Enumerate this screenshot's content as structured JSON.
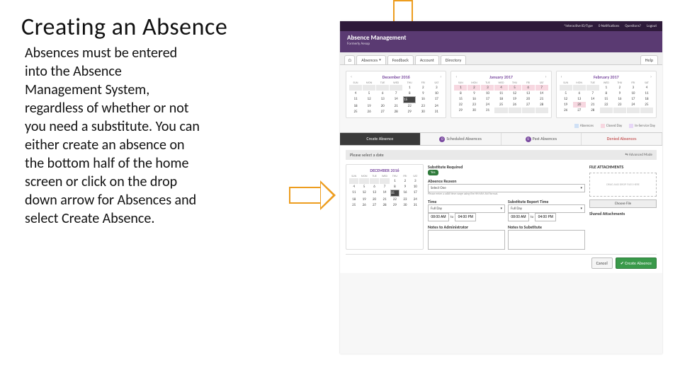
{
  "slide": {
    "title": "Creating an Absence",
    "body": "Absences must be entered into the Absence Management System, regardless of whether or not you need a substitute.  You can either create an absence on the bottom half of the home screen or click on the drop down arrow for Absences and select Create Absence."
  },
  "topbar": {
    "idtype": "*Interactive ID/Type",
    "notif": "0 Notifications",
    "questions": "Questions?",
    "logout": "Logout"
  },
  "brand": {
    "title": "Absence Management",
    "subtitle": "Formerly Aesop"
  },
  "tabs": {
    "home": "⌂",
    "absences": "Absences",
    "feedback": "Feedback",
    "account": "Account",
    "directory": "Directory",
    "help": "Help"
  },
  "dow": [
    "SUN",
    "MON",
    "TUE",
    "WED",
    "THU",
    "FRI",
    "SAT"
  ],
  "months": [
    {
      "title": "December 2016",
      "weeks": [
        [
          "",
          "",
          "",
          "",
          "1",
          "2",
          "3"
        ],
        [
          "4",
          "5",
          "6",
          "7",
          "8",
          "9",
          "10"
        ],
        [
          "11",
          "12",
          "13",
          "14",
          "15",
          "16",
          "17"
        ],
        [
          "18",
          "19",
          "20",
          "21",
          "22",
          "23",
          "24"
        ],
        [
          "25",
          "26",
          "27",
          "28",
          "29",
          "30",
          "31"
        ]
      ],
      "sel": "15"
    },
    {
      "title": "January 2017",
      "weeks": [
        [
          "1",
          "2",
          "3",
          "4",
          "5",
          "6",
          "7"
        ],
        [
          "8",
          "9",
          "10",
          "11",
          "12",
          "13",
          "14"
        ],
        [
          "15",
          "16",
          "17",
          "18",
          "19",
          "20",
          "21"
        ],
        [
          "22",
          "23",
          "24",
          "25",
          "26",
          "27",
          "28"
        ],
        [
          "29",
          "30",
          "31",
          "",
          "",
          "",
          ""
        ]
      ],
      "pink_first_row": true
    },
    {
      "title": "February 2017",
      "weeks": [
        [
          "",
          "",
          "",
          "1",
          "2",
          "3",
          "4"
        ],
        [
          "5",
          "6",
          "7",
          "8",
          "9",
          "10",
          "11"
        ],
        [
          "12",
          "13",
          "14",
          "15",
          "16",
          "17",
          "18"
        ],
        [
          "19",
          "20",
          "21",
          "22",
          "23",
          "24",
          "25"
        ],
        [
          "26",
          "27",
          "28",
          "",
          "",
          "",
          ""
        ]
      ],
      "pink_cell": "20"
    }
  ],
  "legend": {
    "absences": "Absences",
    "closed": "Closed Day",
    "service": "In-Service Day"
  },
  "subtabs": {
    "create": "Create Absence",
    "scheduled": "Scheduled Absences",
    "past": "Past Absences",
    "denied": "Denied Absences",
    "count_sched": "0",
    "count_past": "0"
  },
  "form": {
    "prompt": "Please select a date",
    "advanced": "Advanced Mode",
    "sub_required_label": "Substitute Required",
    "sub_required_value": "Yes",
    "reason_label": "Absence Reason",
    "reason_value": "Select One",
    "reason_hint": "Please enter a valid time range using the HH:MM AM format.",
    "time_label": "Time",
    "srt_label": "Substitute Report Time",
    "daypart": "Full Day",
    "time_from": "08:00 AM",
    "time_to": "04:00 PM",
    "srt_from": "08:00 AM",
    "srt_to": "04:00 PM",
    "to_word": "to",
    "notes_admin": "Notes to Administrator",
    "notes_sub": "Notes to Substitute",
    "file_header": "FILE ATTACHMENTS",
    "dropzone": "DRAG AND DROP FILES HERE",
    "choose_file": "Choose File",
    "shared_header": "Shared Attachments"
  },
  "buttons": {
    "cancel": "Cancel",
    "create": "Create Absence"
  },
  "mini_month_title": "DECEMBER 2016"
}
